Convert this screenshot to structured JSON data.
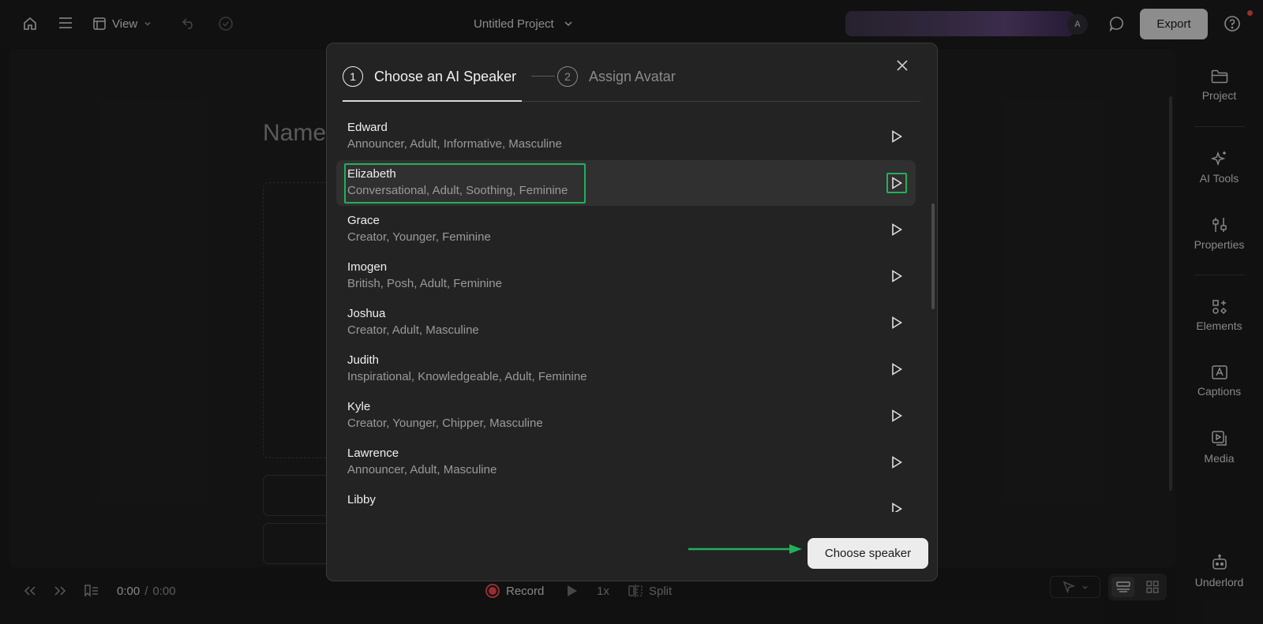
{
  "topbar": {
    "view_label": "View",
    "project_title": "Untitled Project",
    "avatar_initial": "A",
    "export_label": "Export"
  },
  "background": {
    "heading_partial": "Name"
  },
  "bottombar": {
    "time_current": "0:00",
    "time_separator": "/",
    "time_total": "0:00",
    "record_label": "Record",
    "speed_label": "1x",
    "split_label": "Split"
  },
  "sidebar": {
    "items": [
      {
        "label": "Project",
        "icon": "folder-icon"
      },
      {
        "label": "AI Tools",
        "icon": "sparkle-icon"
      },
      {
        "label": "Properties",
        "icon": "sliders-icon"
      },
      {
        "label": "Elements",
        "icon": "shapes-icon"
      },
      {
        "label": "Captions",
        "icon": "captions-icon"
      },
      {
        "label": "Media",
        "icon": "media-icon"
      },
      {
        "label": "Underlord",
        "icon": "robot-icon"
      }
    ]
  },
  "modal": {
    "steps": [
      {
        "number": "1",
        "label": "Choose an AI Speaker",
        "active": true
      },
      {
        "number": "2",
        "label": "Assign Avatar",
        "active": false
      }
    ],
    "speakers": [
      {
        "name": "Edward",
        "desc": "Announcer, Adult, Informative, Masculine"
      },
      {
        "name": "Elizabeth",
        "desc": "Conversational, Adult, Soothing, Feminine",
        "highlighted": true
      },
      {
        "name": "Grace",
        "desc": "Creator, Younger, Feminine"
      },
      {
        "name": "Imogen",
        "desc": "British, Posh, Adult, Feminine"
      },
      {
        "name": "Joshua",
        "desc": "Creator, Adult, Masculine"
      },
      {
        "name": "Judith",
        "desc": "Inspirational, Knowledgeable, Adult, Feminine"
      },
      {
        "name": "Kyle",
        "desc": "Creator, Younger, Chipper, Masculine"
      },
      {
        "name": "Lawrence",
        "desc": "Announcer, Adult, Masculine"
      },
      {
        "name": "Libby",
        "desc": ""
      }
    ],
    "choose_button": "Choose speaker"
  },
  "colors": {
    "highlight": "#22b05b",
    "record": "#e5484d",
    "export_bg": "#d9d9d9"
  }
}
